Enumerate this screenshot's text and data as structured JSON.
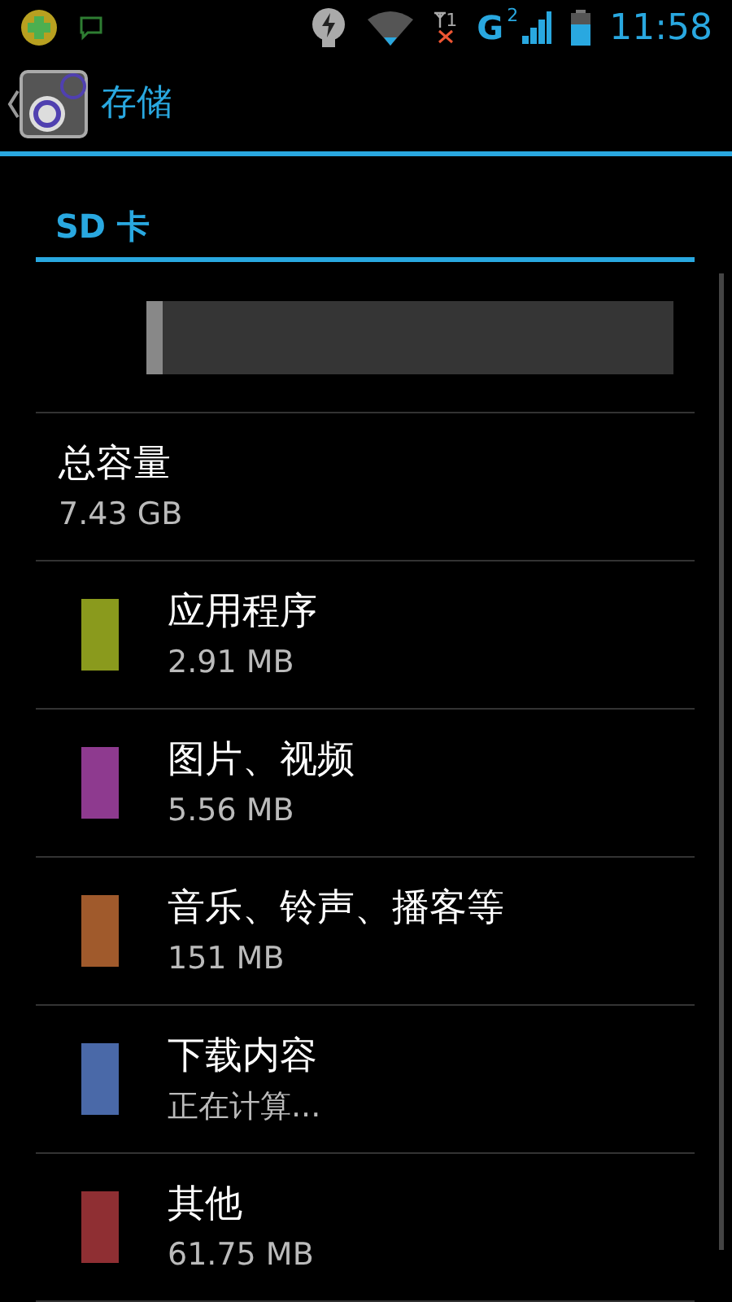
{
  "status_bar": {
    "time": "11:58",
    "sim1": "1",
    "sim2": "2",
    "network": "G"
  },
  "action_bar": {
    "title": "存储"
  },
  "section": {
    "title": "SD 卡"
  },
  "usage": {
    "level": 0.03
  },
  "total": {
    "label": "总容量",
    "value": "7.43 GB"
  },
  "categories": [
    {
      "name": "应用程序",
      "size": "2.91 MB",
      "color": "#8a9a1d"
    },
    {
      "name": "图片、视频",
      "size": "5.56 MB",
      "color": "#8e3a8f"
    },
    {
      "name": "音乐、铃声、播客等",
      "size": "151 MB",
      "color": "#a05a2c"
    },
    {
      "name": "下载内容",
      "size": "正在计算...",
      "color": "#4a69a8"
    },
    {
      "name": "其他",
      "size": "61.75 MB",
      "color": "#8f2f33"
    }
  ]
}
